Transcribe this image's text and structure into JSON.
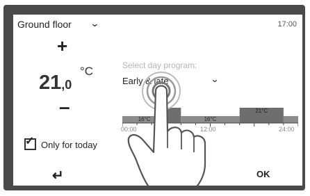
{
  "header": {
    "zone": "Ground floor",
    "time": "17:00"
  },
  "temperature": {
    "plus_label": "+",
    "minus_label": "–",
    "value_int": "21",
    "value_dec": ",0",
    "unit": "°C"
  },
  "program": {
    "label": "Select day program:",
    "selected": "Early & late"
  },
  "timeline": {
    "segments": [
      {
        "label": "16°C",
        "start": 0,
        "end": 6,
        "level": "low"
      },
      {
        "label": "",
        "start": 6,
        "end": 8,
        "level": "high"
      },
      {
        "label": "16°C",
        "start": 8,
        "end": 16,
        "level": "low"
      },
      {
        "label": "21°C",
        "start": 16,
        "end": 22,
        "level": "high"
      },
      {
        "label": "",
        "start": 22,
        "end": 24,
        "level": "low"
      }
    ],
    "tick_labels": [
      "00:00",
      "12:00",
      "24:00"
    ],
    "low_color": "#8c8c8c",
    "high_color": "#6e6e6e"
  },
  "options": {
    "only_today_label": "Only for today",
    "only_today_checked": true
  },
  "footer": {
    "back_icon": "back-arrow-icon",
    "ok_label": "OK"
  },
  "overlay": {
    "icon": "touch-hand-icon"
  }
}
